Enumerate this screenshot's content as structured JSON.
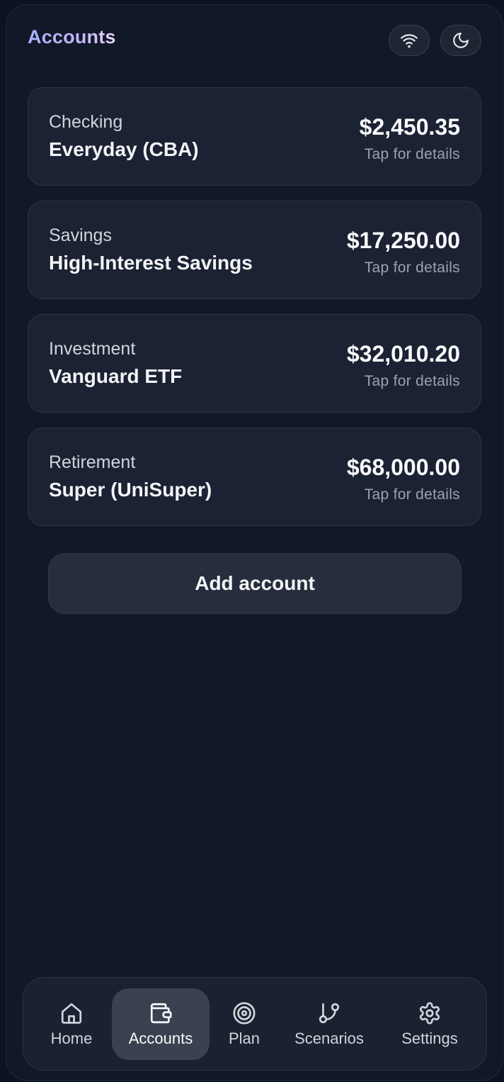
{
  "header": {
    "title": "Accounts",
    "wifi_icon": "wifi-icon",
    "theme_icon": "moon-icon"
  },
  "accounts": [
    {
      "type": "Checking",
      "name": "Everyday (CBA)",
      "amount": "$2,450.35",
      "hint": "Tap for details"
    },
    {
      "type": "Savings",
      "name": "High-Interest Savings",
      "amount": "$17,250.00",
      "hint": "Tap for details"
    },
    {
      "type": "Investment",
      "name": "Vanguard ETF",
      "amount": "$32,010.20",
      "hint": "Tap for details"
    },
    {
      "type": "Retirement",
      "name": "Super (UniSuper)",
      "amount": "$68,000.00",
      "hint": "Tap for details"
    }
  ],
  "add_account_label": "Add account",
  "tabs": [
    {
      "label": "Home",
      "icon": "home-icon"
    },
    {
      "label": "Accounts",
      "icon": "wallet-icon",
      "active": true
    },
    {
      "label": "Plan",
      "icon": "target-icon"
    },
    {
      "label": "Scenarios",
      "icon": "git-branch-icon"
    },
    {
      "label": "Settings",
      "icon": "gear-icon"
    }
  ],
  "colors": {
    "background": "#111827",
    "card": "#1b2233",
    "title_gradient_start": "#a5b4fc",
    "title_gradient_end": "#e9d5ff",
    "active_tab": "#3a4252"
  }
}
